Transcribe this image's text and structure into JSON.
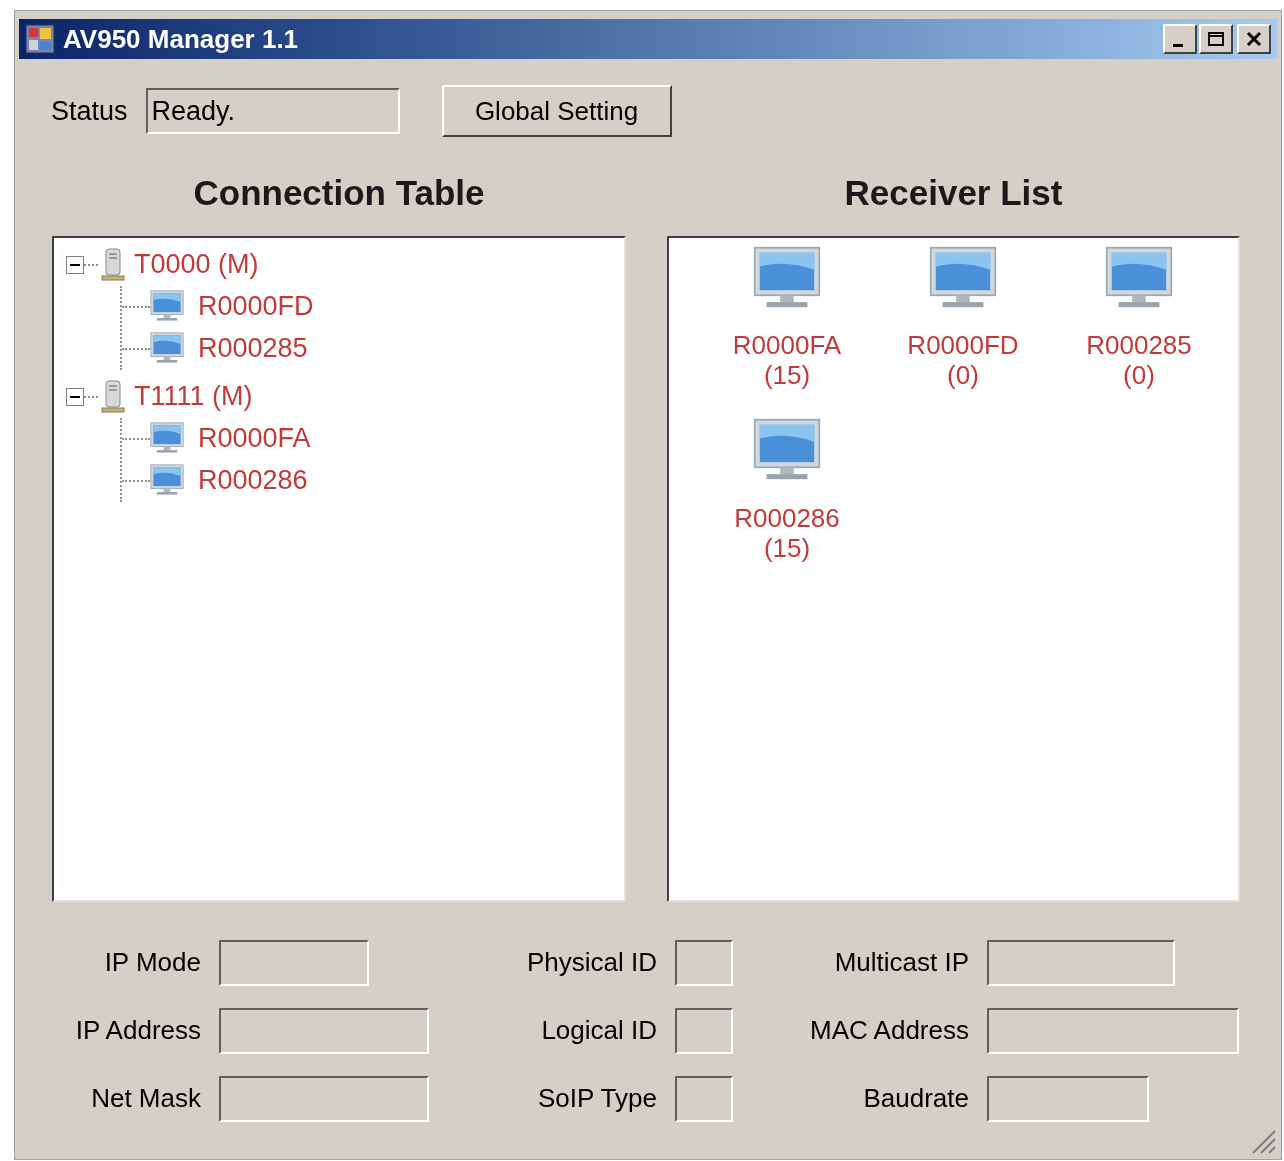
{
  "window": {
    "title": "AV950 Manager 1.1"
  },
  "status": {
    "label": "Status",
    "value": "Ready."
  },
  "global_setting_button": "Global Setting",
  "connection_table": {
    "title": "Connection Table",
    "tree": [
      {
        "label": "T0000 (M)",
        "expanded": true,
        "children": [
          {
            "label": "R0000FD"
          },
          {
            "label": "R000285"
          }
        ]
      },
      {
        "label": "T1111 (M)",
        "expanded": true,
        "children": [
          {
            "label": "R0000FA"
          },
          {
            "label": "R000286"
          }
        ]
      }
    ]
  },
  "receiver_list": {
    "title": "Receiver List",
    "items": [
      {
        "name": "R0000FA",
        "count": "(15)"
      },
      {
        "name": "R0000FD",
        "count": "(0)"
      },
      {
        "name": "R000285",
        "count": "(0)"
      },
      {
        "name": "R000286",
        "count": "(15)"
      }
    ]
  },
  "fields": [
    [
      {
        "label": "IP Mode"
      },
      {
        "label": "IP Address"
      },
      {
        "label": "Net Mask"
      }
    ],
    [
      {
        "label": "Physical ID"
      },
      {
        "label": "Logical ID"
      },
      {
        "label": "SoIP Type"
      }
    ],
    [
      {
        "label": "Multicast IP"
      },
      {
        "label": "MAC Address"
      },
      {
        "label": "Baudrate"
      }
    ]
  ]
}
